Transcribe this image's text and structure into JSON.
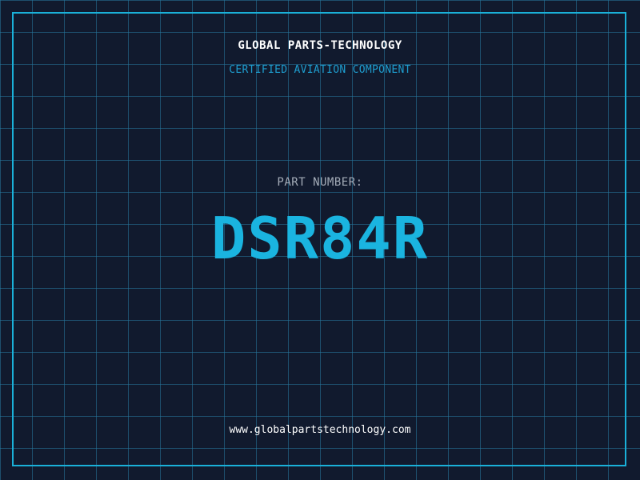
{
  "header": {
    "company": "GLOBAL PARTS-TECHNOLOGY",
    "subtitle": "CERTIFIED AVIATION COMPONENT"
  },
  "part": {
    "label": "PART NUMBER:",
    "number": "DSR84R"
  },
  "footer": {
    "url": "www.globalpartstechnology.com"
  },
  "colors": {
    "background": "#111a2e",
    "grid": "#26789f",
    "frame": "#1ab0d8",
    "accent": "#1ab4e0"
  }
}
